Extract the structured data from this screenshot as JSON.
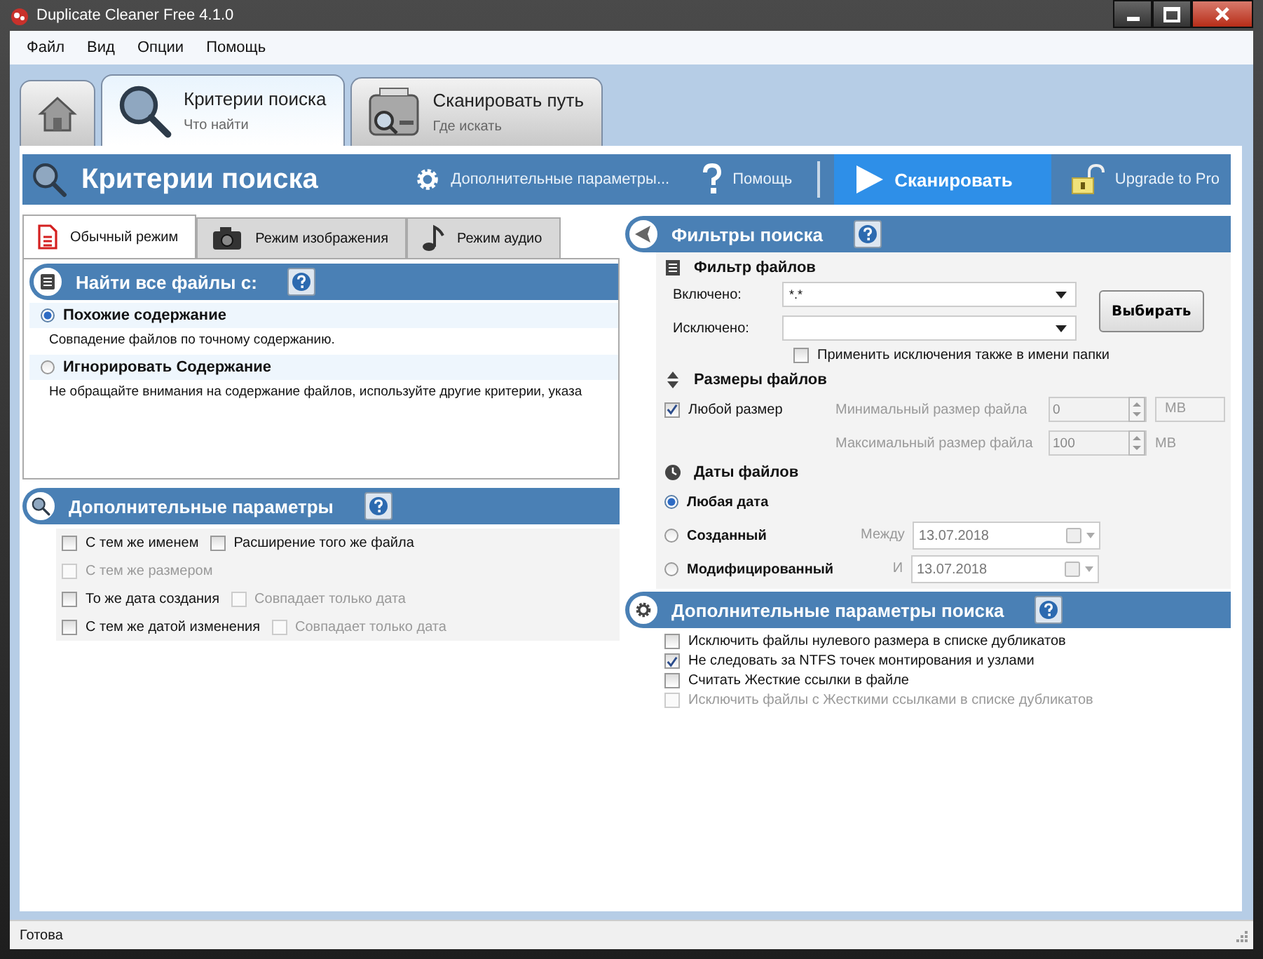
{
  "window": {
    "title": "Duplicate Cleaner Free 4.1.0"
  },
  "menu": [
    "Файл",
    "Вид",
    "Опции",
    "Помощь"
  ],
  "nav_tabs": [
    {
      "kind": "home",
      "selected": false
    },
    {
      "kind": "search",
      "title": "Критерии поиска",
      "subtitle": "Что найти",
      "selected": true
    },
    {
      "kind": "scan",
      "title": "Сканировать путь",
      "subtitle": "Где искать",
      "selected": false
    }
  ],
  "toolbar": {
    "title": "Критерии поиска",
    "actions": [
      {
        "kind": "settings",
        "label": "Дополнительные параметры..."
      },
      {
        "kind": "help",
        "label": "Помощь"
      },
      {
        "kind": "scan",
        "label": "Сканировать"
      },
      {
        "kind": "upgrade",
        "label": "Upgrade to Pro"
      }
    ]
  },
  "mode_tabs": [
    {
      "kind": "document",
      "label": "Обычный режим",
      "selected": true
    },
    {
      "kind": "camera",
      "label": "Режим изображения",
      "selected": false
    },
    {
      "kind": "music",
      "label": "Режим аудио",
      "selected": false
    }
  ],
  "find_section": {
    "title": "Найти все файлы с:",
    "options": [
      {
        "label": "Похожие содержание",
        "description": "Совпадение файлов по точному содержанию.",
        "selected": true
      },
      {
        "label": "Игнорировать Содержание",
        "description": "Не обращайте внимания на содержание файлов, используйте другие критерии, указа",
        "selected": false
      }
    ]
  },
  "extra_params": {
    "title": "Дополнительные параметры",
    "rows": [
      [
        {
          "label": "С тем же именем",
          "checked": false,
          "disabled": false
        },
        {
          "label": "Расширение того же файла",
          "checked": false,
          "disabled": false
        }
      ],
      [
        {
          "label": "С тем же размером",
          "checked": false,
          "disabled": true
        }
      ],
      [
        {
          "label": "То же дата создания",
          "checked": false,
          "disabled": false
        },
        {
          "label": "Совпадает только дата",
          "checked": false,
          "disabled": true
        }
      ],
      [
        {
          "label": "С тем же датой изменения",
          "checked": false,
          "disabled": false
        },
        {
          "label": "Совпадает только дата",
          "checked": false,
          "disabled": true
        }
      ]
    ]
  },
  "filters": {
    "title": "Фильтры поиска",
    "file_filter": {
      "title": "Фильтр файлов",
      "include_label": "Включено:",
      "include_value": "*.*",
      "exclude_label": "Исключено:",
      "choose_button": "Выбирать",
      "apply_folder": {
        "label": "Применить исключения также в имени папки",
        "checked": false
      }
    },
    "sizes": {
      "title": "Размеры файлов",
      "any_size": {
        "label": "Любой размер",
        "checked": true
      },
      "min_label": "Минимальный размер файла",
      "min_value": "0",
      "min_unit": "MB",
      "max_label": "Максимальный размер файла",
      "max_value": "100",
      "max_unit": "MB"
    },
    "dates": {
      "title": "Даты файлов",
      "options": [
        {
          "label": "Любая дата",
          "selected": true
        },
        {
          "label": "Созданный",
          "selected": false,
          "range_label": "Между",
          "value": "13.07.2018"
        },
        {
          "label": "Модифицированный",
          "selected": false,
          "range_label": "И",
          "value": "13.07.2018"
        }
      ]
    }
  },
  "advanced": {
    "title": "Дополнительные параметры поиска",
    "options": [
      {
        "label": "Исключить файлы нулевого размера в списке дубликатов",
        "checked": false,
        "disabled": false
      },
      {
        "label": "Не следовать за NTFS точек монтирования и узлами",
        "checked": true,
        "disabled": false
      },
      {
        "label": "Считать Жесткие ссылки в файле",
        "checked": false,
        "disabled": false
      },
      {
        "label": "Исключить файлы с Жесткими ссылками в списке дубликатов",
        "checked": false,
        "disabled": true
      }
    ]
  },
  "status_bar": {
    "text": "Готова"
  }
}
